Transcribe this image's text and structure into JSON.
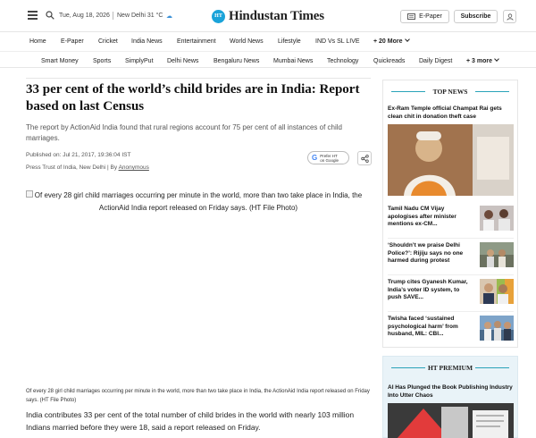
{
  "header": {
    "date": "Tue, Aug 18, 2026",
    "weather": "New Delhi 31 °C",
    "logo_badge": "HT",
    "logo_text": "Hindustan Times",
    "epaper_label": "E-Paper",
    "subscribe_label": "Subscribe"
  },
  "nav_primary": [
    "Home",
    "E-Paper",
    "Cricket",
    "India News",
    "Entertainment",
    "World News",
    "Lifestyle",
    "IND Vs SL LIVE"
  ],
  "nav_primary_more": "+ 20 More",
  "nav_secondary": [
    "Smart Money",
    "Sports",
    "SimplyPut",
    "Delhi News",
    "Bengaluru News",
    "Mumbai News",
    "Technology",
    "Quickreads",
    "Daily Digest"
  ],
  "nav_secondary_more": "+ 3 more",
  "article": {
    "headline": "33 per cent of the world’s child brides are in India: Report based on last Census",
    "summary": "The report by ActionAid India found that rural regions account for 75 per cent of all instances of child marriages.",
    "published": "Published on: Jul 21, 2017, 19:36:04 IST",
    "byline_prefix": "Press Trust of India, New Delhi | By ",
    "author": "Anonymous",
    "google_line1": "Prefer HT",
    "google_line2": "on Google",
    "google_g": "G",
    "image_alt": "Of every 28 girl child marriages occurring per minute in the world, more than two take place in India, the ActionAid India report released on Friday says. (HT File Photo)",
    "caption": "Of every 28 girl child marriages occurring per minute in the world, more than two take place in India, the ActionAid India report released on Friday says. (HT File Photo)",
    "body": "India contributes 33 per cent of the total number of child brides in the world with nearly 103 million Indians married before they were 18, said a report released on Friday."
  },
  "top_news": {
    "title": "TOP NEWS",
    "lead": "Ex-Ram Temple official Champat Rai gets clean chit in donation theft case",
    "items": [
      "Tamil Nadu CM Vijay apologises after minister mentions ex-CM...",
      "‘Shouldn’t we praise Delhi Police?’: Rijiju says no one harmed during protest",
      "Trump cites Gyanesh Kumar, India’s voter ID system, to push SAVE...",
      "Twisha faced ‘sustained psychological harm’ from husband, MIL: CBI..."
    ]
  },
  "ht_premium": {
    "title": "HT PREMIUM",
    "lead": "AI Has Plunged the Book Publishing Industry Into Utter Chaos"
  },
  "colors": {
    "accent": "#2aa3b9",
    "logo_blue": "#1aa3d9",
    "premium_bg": "#e9f3f8"
  }
}
